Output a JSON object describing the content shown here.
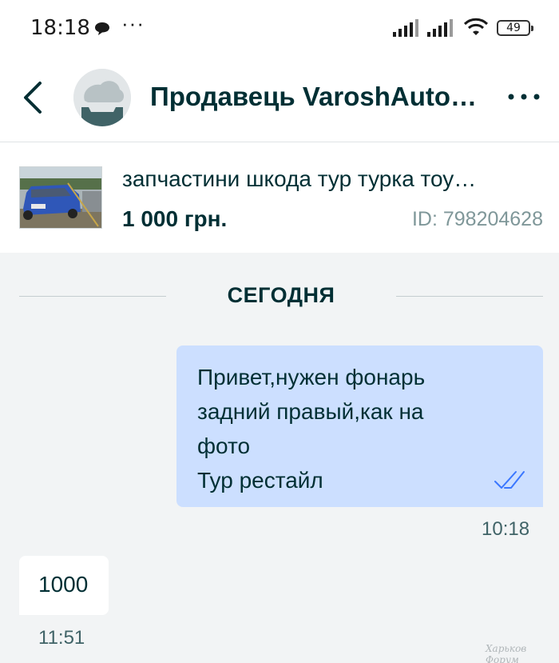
{
  "status_bar": {
    "time": "18:18",
    "dots": "···",
    "battery": "49"
  },
  "header": {
    "seller_name": "Продавець VaroshAuto…"
  },
  "ad": {
    "title": "запчастини шкода тур турка тоу…",
    "price": "1 000 грн.",
    "id": "ID: 798204628"
  },
  "chat": {
    "date_separator": "СЕГОДНЯ",
    "messages": [
      {
        "direction": "outgoing",
        "text": "Привет,нужен фонарь\nзадний правый,как на\nфото\nТур рестайл",
        "time": "10:18",
        "status": "read"
      },
      {
        "direction": "incoming",
        "text": "1000",
        "time": "11:51"
      }
    ]
  },
  "watermark": "Харьков Форум",
  "colors": {
    "primary": "#002f34",
    "outgoing_bubble": "#ccdfff",
    "background": "#f2f4f5",
    "read_check": "#3a77ff"
  }
}
